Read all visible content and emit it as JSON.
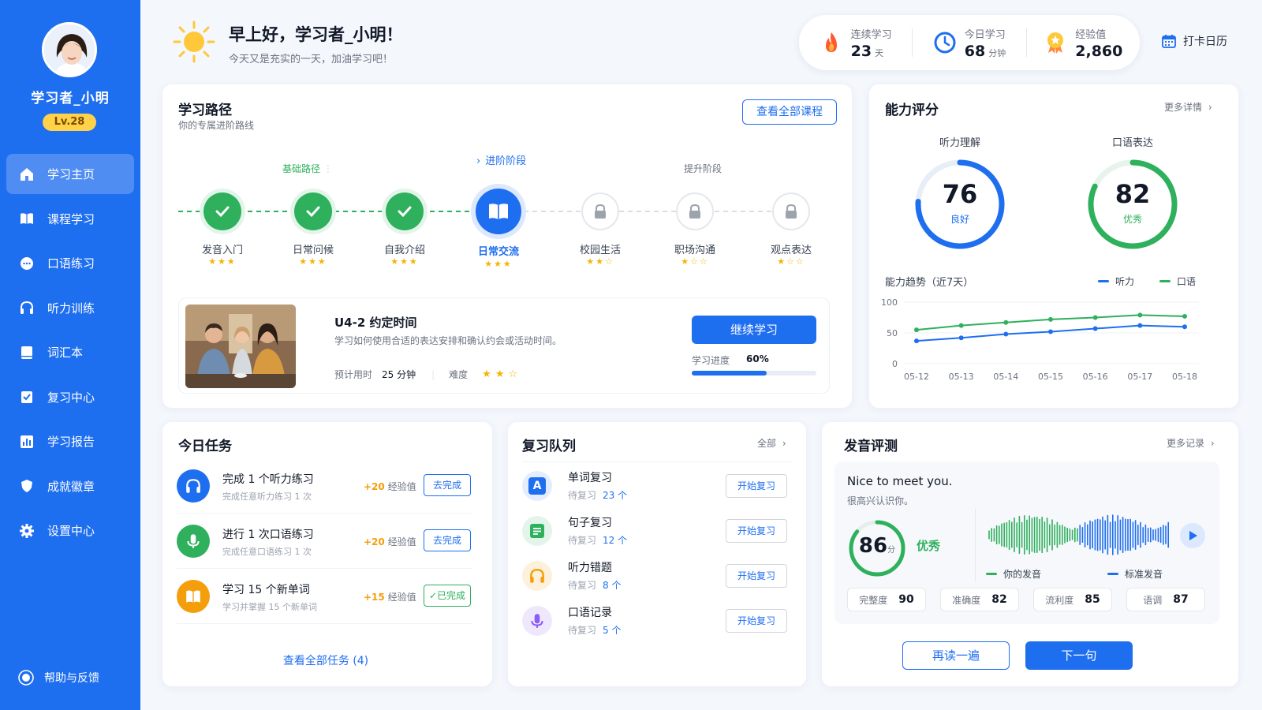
{
  "sidebar": {
    "username": "学习者_小明",
    "level": "Lv.28",
    "items": [
      {
        "label": "学习主页",
        "icon": "home-icon",
        "active": true
      },
      {
        "label": "课程学习",
        "icon": "book-icon",
        "active": false
      },
      {
        "label": "口语练习",
        "icon": "chat-icon",
        "active": false
      },
      {
        "label": "听力训练",
        "icon": "headphones-icon",
        "active": false
      },
      {
        "label": "词汇本",
        "icon": "notebook-icon",
        "active": false
      },
      {
        "label": "复习中心",
        "icon": "review-icon",
        "active": false
      },
      {
        "label": "学习报告",
        "icon": "report-icon",
        "active": false
      },
      {
        "label": "成就徽章",
        "icon": "badge-icon",
        "active": false
      },
      {
        "label": "设置中心",
        "icon": "gear-icon",
        "active": false
      }
    ],
    "help": "帮助与反馈"
  },
  "header": {
    "greeting": "早上好，学习者_小明！",
    "subtitle": "今天又是充实的一天，加油学习吧！",
    "stats": [
      {
        "label": "连续学习",
        "value": "23",
        "unit": "天",
        "icon": "fire-icon"
      },
      {
        "label": "今日学习",
        "value": "68",
        "unit": "分钟",
        "icon": "clock-icon"
      },
      {
        "label": "经验值",
        "value": "2,860",
        "unit": "",
        "icon": "medal-icon"
      }
    ],
    "calendar": "打卡日历"
  },
  "path": {
    "title": "学习路径",
    "subtitle": "你的专属进阶路线",
    "button": "查看全部课程",
    "stages": {
      "basic": "基础路径",
      "advanced": "进阶阶段",
      "improve": "提升阶段"
    },
    "nodes": [
      {
        "label": "发音入门",
        "status": "done",
        "stars": "★★★"
      },
      {
        "label": "日常问候",
        "status": "done",
        "stars": "★★★"
      },
      {
        "label": "自我介绍",
        "status": "done",
        "stars": "★★★"
      },
      {
        "label": "日常交流",
        "status": "current",
        "stars": "★★★"
      },
      {
        "label": "校园生活",
        "status": "locked",
        "stars": "★★☆"
      },
      {
        "label": "职场沟通",
        "status": "locked",
        "stars": "★☆☆"
      },
      {
        "label": "观点表达",
        "status": "locked",
        "stars": "★☆☆"
      }
    ],
    "lesson": {
      "title": "U4-2  约定时间",
      "desc": "学习如何使用合适的表达安排和确认约会或活动时间。",
      "time_label": "预计用时",
      "time_value": "25 分钟",
      "difficulty_label": "难度",
      "difficulty_stars": "★★☆",
      "button": "继续学习",
      "progress_label": "学习进度",
      "progress_value": "60%",
      "progress": 0.6
    }
  },
  "ability": {
    "title": "能力评分",
    "more": "更多详情",
    "gauges": [
      {
        "label": "听力理解",
        "score": "76",
        "tag": "良好",
        "fraction": 0.76,
        "color": "#1e6ef0"
      },
      {
        "label": "口语表达",
        "score": "82",
        "tag": "优秀",
        "fraction": 0.82,
        "color": "#2eb05c"
      }
    ],
    "trend_label": "能力趋势（近7天）",
    "legend": [
      "听力",
      "口语"
    ]
  },
  "chart_data": {
    "type": "line",
    "x": [
      "05-12",
      "05-13",
      "05-14",
      "05-15",
      "05-16",
      "05-17",
      "05-18"
    ],
    "ylim": [
      0,
      100
    ],
    "yticks": [
      "100",
      "50",
      "0"
    ],
    "series": [
      {
        "name": "听力",
        "values": [
          37,
          42,
          48,
          52,
          57,
          62,
          60
        ],
        "color": "#1e6ef0"
      },
      {
        "name": "口语",
        "values": [
          55,
          62,
          67,
          72,
          75,
          79,
          77
        ],
        "color": "#2eb05c"
      }
    ]
  },
  "tasks": {
    "title": "今日任务",
    "items": [
      {
        "title": "完成 1 个听力练习",
        "desc": "完成任意听力练习 1 次",
        "xp": "+20",
        "xp_label": "经验值",
        "button": "去完成",
        "done": false,
        "icon": "headphones-icon",
        "color": "#1e6ef0"
      },
      {
        "title": "进行 1 次口语练习",
        "desc": "完成任意口语练习 1 次",
        "xp": "+20",
        "xp_label": "经验值",
        "button": "去完成",
        "done": false,
        "icon": "mic-icon",
        "color": "#2eb05c"
      },
      {
        "title": "学习 15 个新单词",
        "desc": "学习并掌握 15 个新单词",
        "xp": "+15",
        "xp_label": "经验值",
        "button": "✓已完成",
        "done": true,
        "icon": "book-icon",
        "color": "#f59e0b"
      }
    ],
    "all": "查看全部任务 (4)"
  },
  "review": {
    "title": "复习队列",
    "all": "全部",
    "items": [
      {
        "title": "单词复习",
        "label": "待复习",
        "count": "23 个",
        "button": "开始复习",
        "icon": "letter-a-icon",
        "color": "#1e6ef0",
        "bg": "#e3edfd"
      },
      {
        "title": "句子复习",
        "label": "待复习",
        "count": "12 个",
        "button": "开始复习",
        "icon": "list-icon",
        "color": "#2eb05c",
        "bg": "#e3f5ea"
      },
      {
        "title": "听力错题",
        "label": "待复习",
        "count": "8 个",
        "button": "开始复习",
        "icon": "headphones-icon",
        "color": "#f59e0b",
        "bg": "#fdf1dc"
      },
      {
        "title": "口语记录",
        "label": "待复习",
        "count": "5 个",
        "button": "开始复习",
        "icon": "mic-icon",
        "color": "#8b5cf6",
        "bg": "#efe8fd"
      }
    ]
  },
  "pron": {
    "title": "发音评测",
    "more": "更多记录",
    "sentence": "Nice to meet you.",
    "translation": "很高兴认识你。",
    "score": "86",
    "score_unit": "分",
    "score_fraction": 0.86,
    "grade": "优秀",
    "legend": [
      "你的发音",
      "标准发音"
    ],
    "scores": [
      {
        "label": "完整度",
        "value": "90"
      },
      {
        "label": "准确度",
        "value": "82"
      },
      {
        "label": "流利度",
        "value": "85"
      },
      {
        "label": "语调",
        "value": "87"
      }
    ],
    "retry": "再读一遍",
    "next": "下一句"
  }
}
